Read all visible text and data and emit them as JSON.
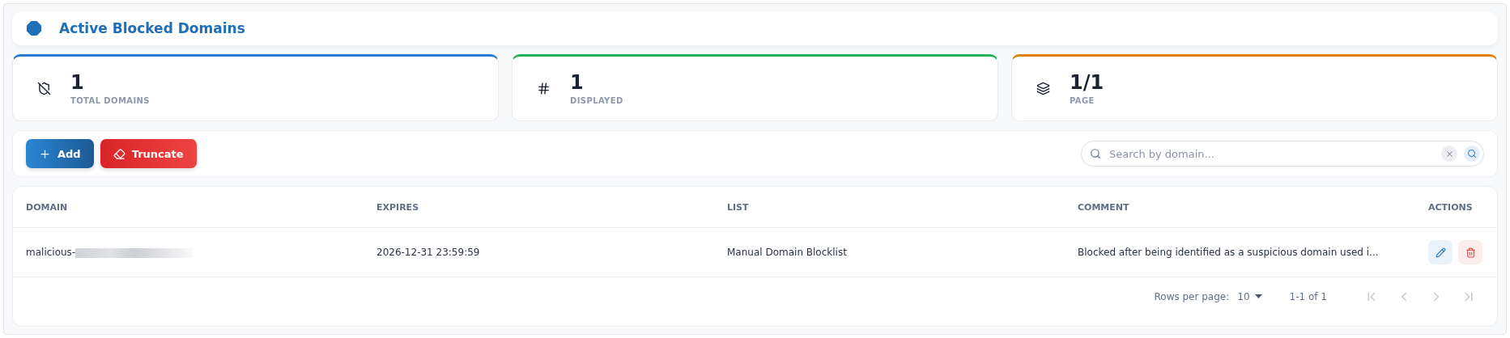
{
  "header": {
    "title": "Active Blocked Domains"
  },
  "stats": [
    {
      "kind": "shield",
      "value": "1",
      "label": "TOTAL DOMAINS",
      "color": "#2b7bd0"
    },
    {
      "kind": "hash",
      "value": "1",
      "label": "DISPLAYED",
      "color": "#22b35a"
    },
    {
      "kind": "layers",
      "value": "1/1",
      "label": "PAGE",
      "color": "#e0820e"
    }
  ],
  "toolbar": {
    "buttons": [
      {
        "kind": "add",
        "label": "Add"
      },
      {
        "kind": "truncate",
        "label": "Truncate"
      }
    ],
    "search": {
      "placeholder": "Search by domain..."
    }
  },
  "table": {
    "columns": [
      "DOMAIN",
      "EXPIRES",
      "LIST",
      "COMMENT",
      "ACTIONS"
    ],
    "rows": [
      {
        "domain": "malicious-",
        "domain_redacted": true,
        "expires": "2026-12-31 23:59:59",
        "list": "Manual Domain Blocklist",
        "comment": "Blocked after being identified as a suspicious domain used i..."
      }
    ]
  },
  "pagination": {
    "rows_per_page_label": "Rows per page:",
    "rows_per_page": "10",
    "range": "1-1 of 1",
    "buttons": [
      {
        "kind": "first",
        "disabled": true
      },
      {
        "kind": "prev",
        "disabled": true
      },
      {
        "kind": "next",
        "disabled": true
      },
      {
        "kind": "last",
        "disabled": true
      }
    ]
  }
}
